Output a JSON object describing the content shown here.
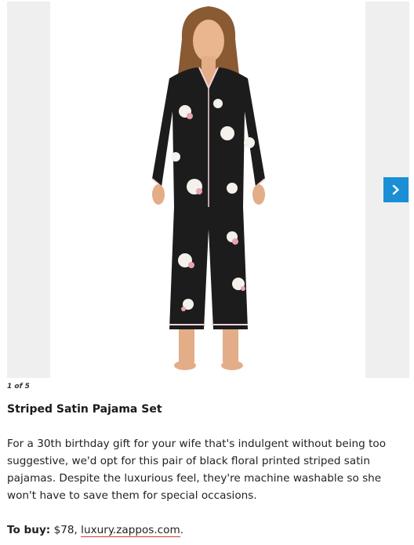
{
  "gallery": {
    "counter": "1 of 5",
    "image_alt": "Woman wearing black floral printed striped satin pajama set",
    "next_icon": "chevron-right-icon",
    "accent_color": "#1a8fd6"
  },
  "product": {
    "title": "Striped Satin Pajama Set",
    "description": "For a 30th birthday gift for your wife that's indulgent without being too suggestive, we'd opt for this pair of black floral printed striped satin pajamas. Despite the luxurious feel, they're machine washable so she won't have to save them for special occasions.",
    "buy_label": "To buy:",
    "price": " $78, ",
    "link_text": "luxury.zappos.com",
    "link_suffix": "."
  }
}
